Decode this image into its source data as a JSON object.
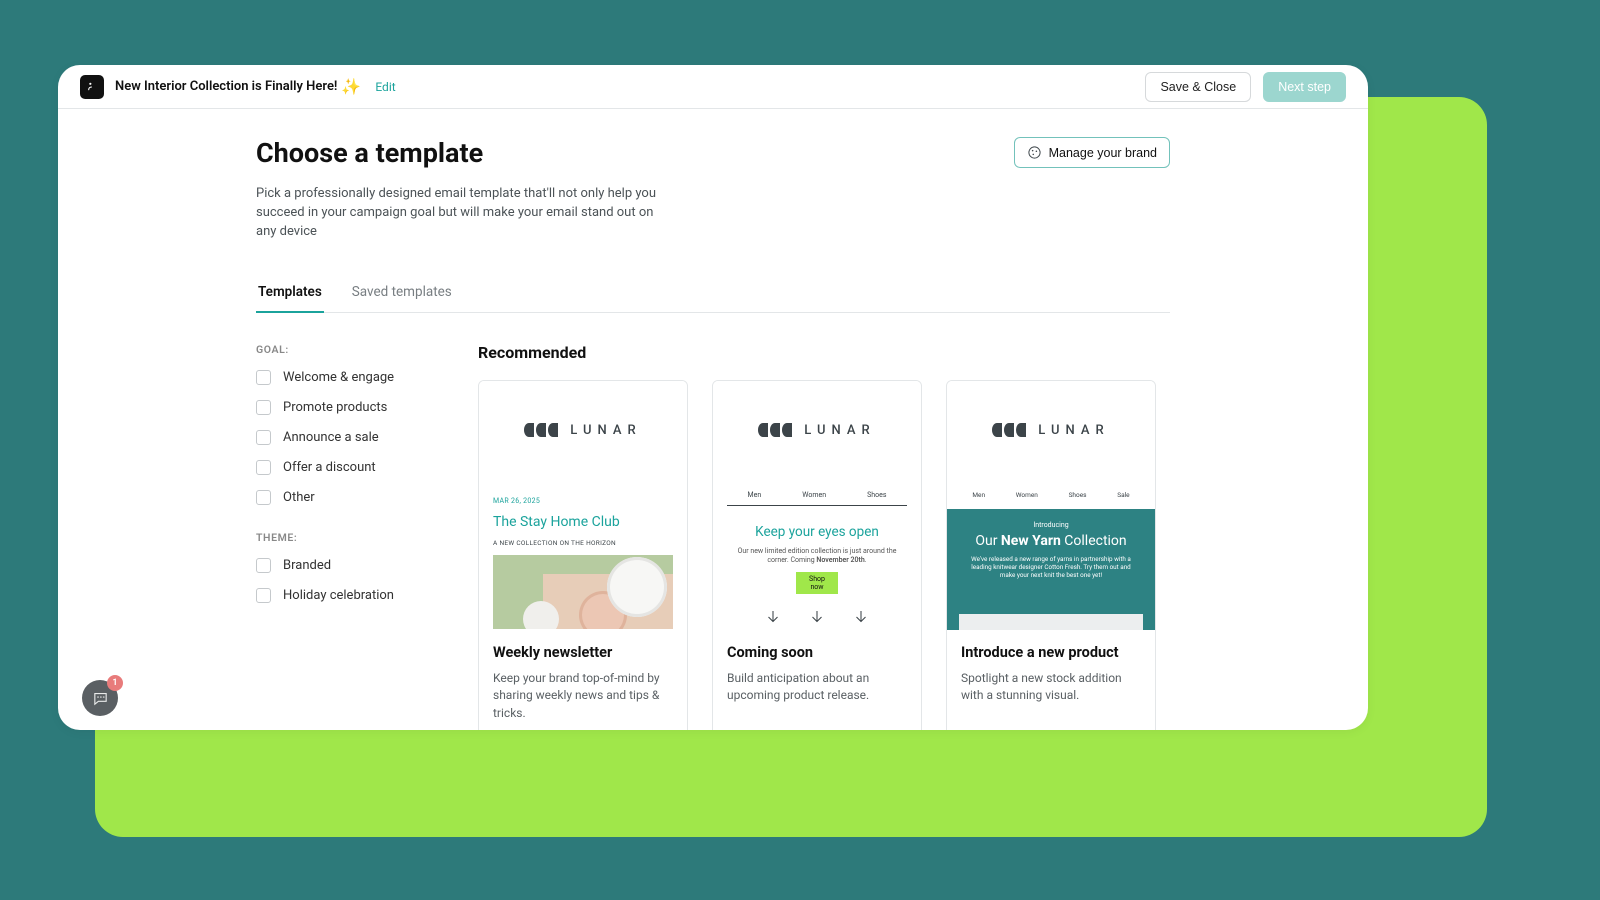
{
  "header": {
    "campaign_title": "New Interior Collection is Finally Here!",
    "sparkle": "✨",
    "edit_label": "Edit",
    "save_close_label": "Save & Close",
    "next_step_label": "Next step"
  },
  "page": {
    "title": "Choose a template",
    "description": "Pick a professionally designed email template that'll not only help you succeed in your campaign goal but will make your email stand out on any device",
    "manage_brand_label": "Manage your brand"
  },
  "tabs": {
    "templates": "Templates",
    "saved_templates": "Saved templates"
  },
  "filters": {
    "goal_label": "GOAL:",
    "goal_items": [
      "Welcome & engage",
      "Promote products",
      "Announce a sale",
      "Offer a discount",
      "Other"
    ],
    "theme_label": "THEME:",
    "theme_items": [
      "Branded",
      "Holiday celebration"
    ]
  },
  "section_title": "Recommended",
  "cards": [
    {
      "title": "Weekly newsletter",
      "desc": "Keep your brand top-of-mind by sharing weekly news and tips & tricks.",
      "preview": {
        "brand": "LUNAR",
        "date": "MAR 26, 2025",
        "headline": "The Stay Home Club",
        "sub": "A NEW COLLECTION ON THE HORIZON"
      }
    },
    {
      "title": "Coming soon",
      "desc": "Build anticipation about an upcoming product release.",
      "preview": {
        "brand": "LUNAR",
        "nav": [
          "Men",
          "Women",
          "Shoes"
        ],
        "headline": "Keep your eyes open",
        "sub_pre": "Our new limited edition collection is just around the corner. Coming ",
        "sub_date": "November 20th",
        "sub_post": ".",
        "cta": "Shop now"
      }
    },
    {
      "title": "Introduce a new product",
      "desc": "Spotlight a new stock addition with a stunning visual.",
      "preview": {
        "brand": "LUNAR",
        "nav": [
          "Men",
          "Women",
          "Shoes",
          "Sale"
        ],
        "intro": "Introducing",
        "title_pre": "Our ",
        "title_bold": "New Yarn",
        "title_post": " Collection",
        "sub": "We've released a new range of yarns in partnership with a leading knitwear designer Cotton Fresh. Try them out and make your next knit the best one yet!"
      }
    }
  ],
  "chat_badge": "1"
}
